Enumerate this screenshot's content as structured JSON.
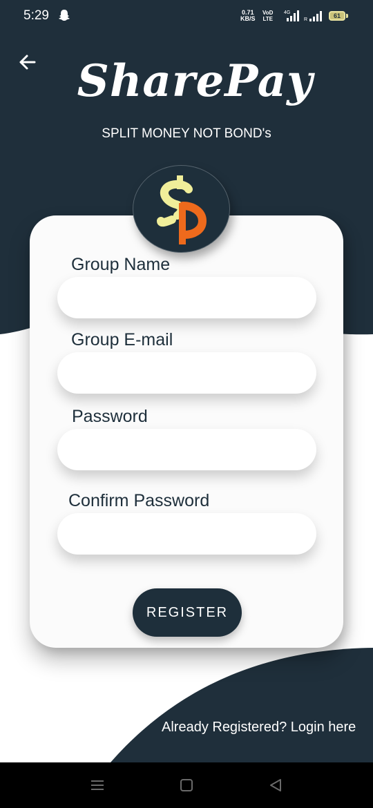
{
  "status_bar": {
    "time": "5:29",
    "net_speed_value": "0.71",
    "net_speed_unit": "KB/S",
    "volte_top": "VoD",
    "volte_bottom": "LTE",
    "battery": "61"
  },
  "header": {
    "app_name": "SharePay",
    "tagline": "SPLIT MONEY NOT BOND's"
  },
  "form": {
    "group_name_label": "Group Name",
    "group_email_label": "Group E-mail",
    "password_label": "Password",
    "confirm_password_label": "Confirm Password",
    "group_name_value": "",
    "group_email_value": "",
    "password_value": "",
    "confirm_password_value": "",
    "register_label": "REGISTER"
  },
  "footer": {
    "login_link": "Already Registered? Login here"
  },
  "colors": {
    "primary_dark": "#1e2f3b",
    "logo_dollar_yellow": "#f0ee9a",
    "logo_dollar_orange": "#ee6a1c"
  },
  "icons": [
    "back-arrow-icon",
    "ghost-icon",
    "signal-icon",
    "battery-icon",
    "menu-icon",
    "home-icon",
    "back-triangle-icon"
  ]
}
